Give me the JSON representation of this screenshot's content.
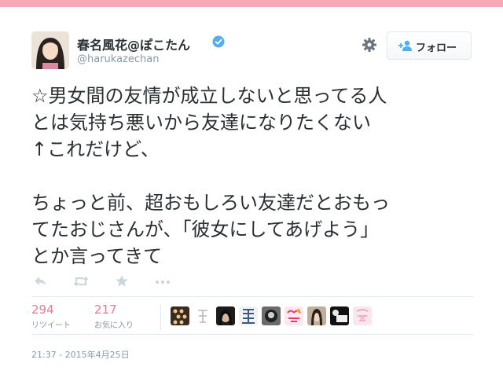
{
  "header": {
    "display_name": "春名風花@ぽこたん",
    "handle": "@harukazechan",
    "follow_label": "フォロー"
  },
  "tweet": {
    "lines": [
      "☆男女間の友情が成立しないと思ってる人",
      "とは気持ち悪いから友達になりたくない",
      "↑これだけど、",
      "",
      "ちょっと前、超おもしろい友達だとおもっ",
      "てたおじさんが、「彼女にしてあげよう」",
      "とか言ってきて"
    ]
  },
  "stats": {
    "retweets": {
      "count": "294",
      "label": "リツイート"
    },
    "favorites": {
      "count": "217",
      "label": "お気に入り"
    }
  },
  "timestamp": "21:37 - 2015年4月25日",
  "colors": {
    "accent_pink": "#e07d97",
    "top_bar": "#f4a9b5",
    "verified_blue": "#55acee",
    "muted_text": "#8899a6"
  },
  "icons": [
    "verified-badge-icon",
    "gear-icon",
    "follow-person-icon",
    "reply-icon",
    "retweet-icon",
    "favorite-star-icon",
    "more-icon"
  ]
}
